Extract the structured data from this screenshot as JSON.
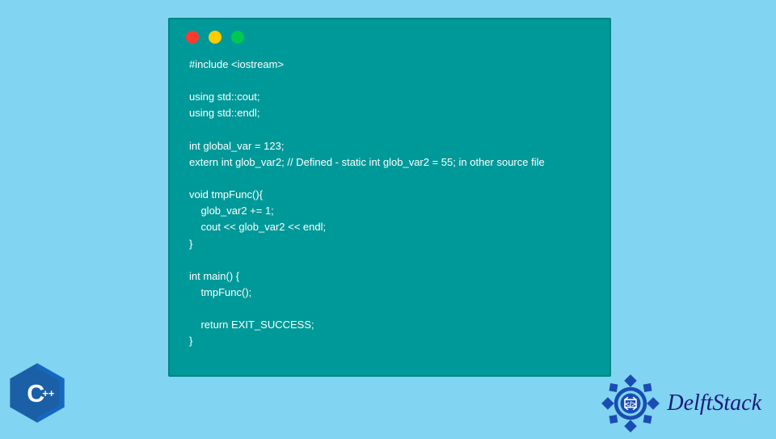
{
  "code": {
    "line1": "#include <iostream>",
    "line2": "",
    "line3": "using std::cout;",
    "line4": "using std::endl;",
    "line5": "",
    "line6": "int global_var = 123;",
    "line7": "extern int glob_var2; // Defined - static int glob_var2 = 55; in other source file",
    "line8": "",
    "line9": "void tmpFunc(){",
    "line10": "    glob_var2 += 1;",
    "line11": "    cout << glob_var2 << endl;",
    "line12": "}",
    "line13": "",
    "line14": "int main() {",
    "line15": "    tmpFunc();",
    "line16": "",
    "line17": "    return EXIT_SUCCESS;",
    "line18": "}"
  },
  "branding": {
    "cpp_label": "C++",
    "delft_label": "DelftStack"
  },
  "colors": {
    "background": "#81d4f2",
    "window_bg": "#009999",
    "dot_red": "#ff3b30",
    "dot_yellow": "#ffcc00",
    "dot_green": "#00c853",
    "code_text": "#ffffff",
    "cpp_blue": "#1b5fa6",
    "delft_blue": "#1a1a7a"
  }
}
